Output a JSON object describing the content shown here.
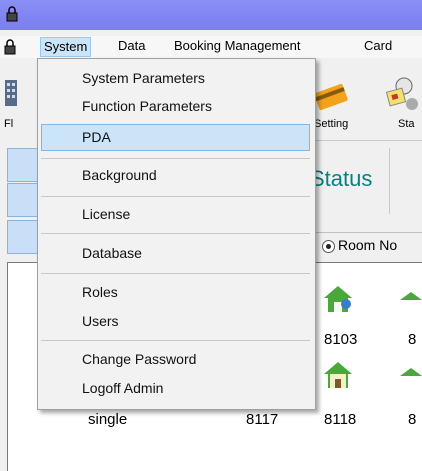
{
  "menubar": {
    "items": [
      "System",
      "Data",
      "Booking Management",
      "Card"
    ]
  },
  "toolbar": {
    "labels": [
      "Fl",
      "Setting",
      "Sta"
    ]
  },
  "system_menu": {
    "items": [
      "System Parameters",
      "Function Parameters",
      "PDA",
      "Background",
      "License",
      "Database",
      "Roles",
      "Users",
      "Change Password",
      "Logoff Admin"
    ],
    "highlighted": "PDA"
  },
  "status_panel": {
    "title": "Status"
  },
  "filter": {
    "room_no_label": "Room No"
  },
  "room_list": {
    "type_label": "single"
  },
  "rooms": {
    "numbers": [
      "8103",
      "8",
      "8117",
      "8118",
      "8"
    ]
  },
  "colors": {
    "titlebar": "#7a7ef0",
    "menu_highlight": "#cce4f7",
    "status_text": "#0a7f7f"
  }
}
